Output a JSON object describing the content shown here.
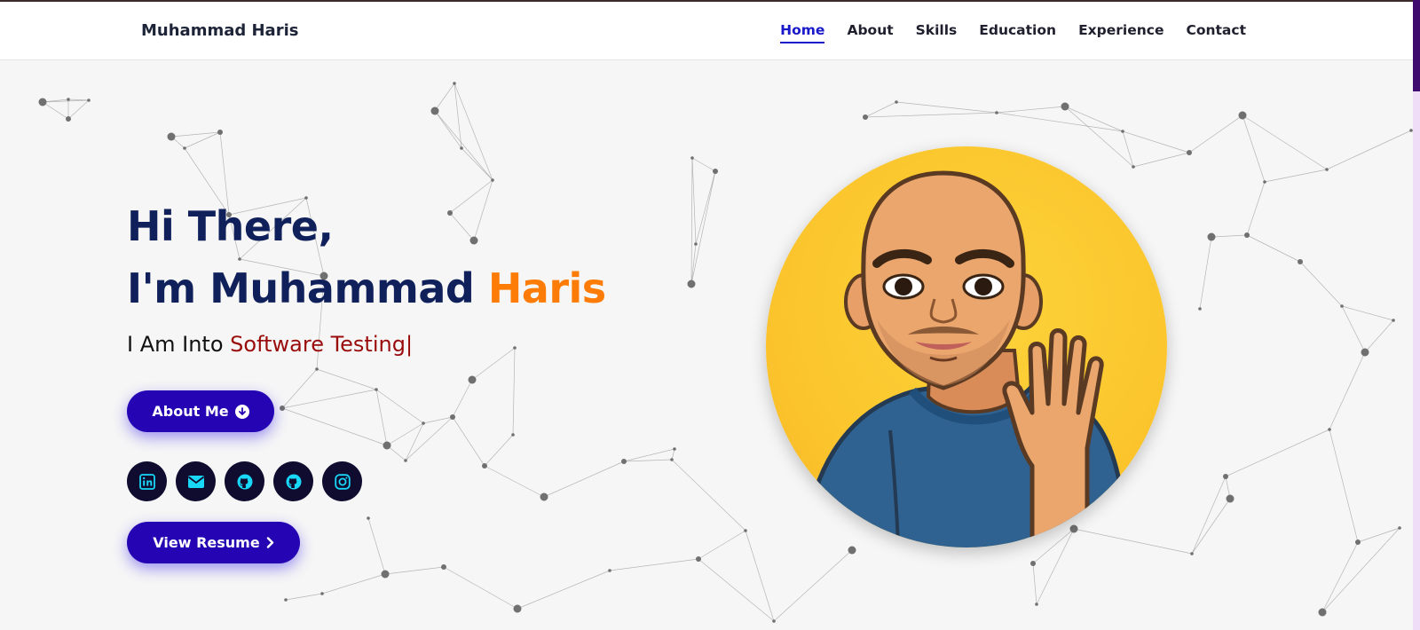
{
  "brand": "Muhammad Haris",
  "nav": {
    "items": [
      "Home",
      "About",
      "Skills",
      "Education",
      "Experience",
      "Contact"
    ],
    "active": "Home"
  },
  "hero": {
    "greeting": "Hi There,",
    "name_prefix": "I'm Muhammad",
    "name_highlight": "Haris",
    "typed_prefix": "I Am Into",
    "typed_role": "Software Testing|"
  },
  "buttons": {
    "about": "About Me",
    "resume": "View Resume"
  },
  "socials": [
    "linkedin-icon",
    "mail-icon",
    "github-icon",
    "github-icon",
    "instagram-icon"
  ],
  "colors": {
    "nav_active": "#1a19c9",
    "heading": "#0f205a",
    "highlight": "#fd7c07",
    "role": "#9a0c0c",
    "button": "#2505b3",
    "social_bg": "#0f0c2f",
    "social_icon": "#18d7f7",
    "avatar_bg": "#fbc52d"
  }
}
